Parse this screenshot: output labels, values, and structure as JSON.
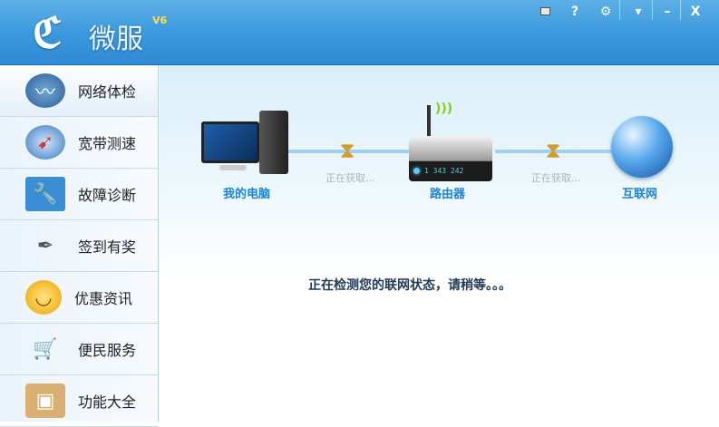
{
  "app": {
    "name": "微服",
    "version": "V6"
  },
  "titlebar": {
    "buttons": [
      "network-port",
      "help",
      "settings",
      "menu",
      "minimize",
      "close"
    ],
    "help_label": "?",
    "close_label": "X",
    "minimize_label": "–",
    "menu_label": "▾"
  },
  "sidebar": {
    "items": [
      {
        "label": "网络体检",
        "icon": "heartbeat"
      },
      {
        "label": "宽带测速",
        "icon": "speedometer"
      },
      {
        "label": "故障诊断",
        "icon": "wrench"
      },
      {
        "label": "签到有奖",
        "icon": "pen"
      },
      {
        "label": "优惠资讯",
        "icon": "smiley"
      },
      {
        "label": "便民服务",
        "icon": "cart"
      },
      {
        "label": "功能大全",
        "icon": "box"
      }
    ]
  },
  "main": {
    "nodes": {
      "computer": "我的电脑",
      "router": "路由器",
      "internet": "互联网"
    },
    "link1_status": "正在获取...",
    "link2_status": "正在获取...",
    "router_display": "1   343 242",
    "status_message": "正在检测您的联网状态，请稍等。。。"
  }
}
